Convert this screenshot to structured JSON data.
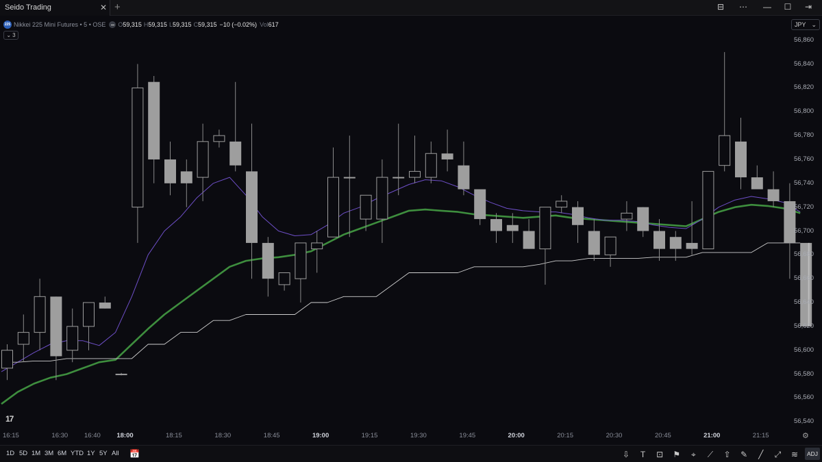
{
  "window": {
    "tab_title": "Seido Trading",
    "tab_close": "✕",
    "new_tab": "+",
    "controls": {
      "layout": "⊟",
      "more": "⋯",
      "minimize": "—",
      "maximize": "☐",
      "close": "✕",
      "exit": "⇥"
    }
  },
  "legend": {
    "badge": "225",
    "symbol": "Nikkei 225 Mini Futures • 5 • OSE",
    "open_label": "O",
    "open": "59,315",
    "high_label": "H",
    "high": "59,315",
    "low_label": "L",
    "low": "59,315",
    "close_label": "C",
    "close": "59,315",
    "change": "−10 (−0.02%)",
    "vol_label": "Vol",
    "vol": "617",
    "indicators_count": "3"
  },
  "currency": {
    "label": "JPY",
    "arrow": "⌄"
  },
  "colors": {
    "background": "#0b0b10",
    "candle": "#9e9e9e",
    "ma_green": "#3e8e3e",
    "ma_purple": "#6e4fc8",
    "baseline": "#cfcfcf"
  },
  "tv_logo": "17",
  "chart_data": {
    "type": "candlestick",
    "price_ticks": [
      56840,
      56820,
      56800,
      56780,
      56760,
      56740,
      56720,
      56700,
      56680,
      56660,
      56640,
      56620,
      56600,
      56580,
      56560,
      56540
    ],
    "price_labels": [
      "56,860",
      "56,840",
      "56,820",
      "56,800",
      "56,780",
      "56,760",
      "56,740",
      "56,720",
      "56,700",
      "56,680",
      "56,660",
      "56,640",
      "56,620",
      "56,600",
      "56,580",
      "56,560",
      "56,540"
    ],
    "ylim": [
      56535,
      56865
    ],
    "time_labels": [
      {
        "label": "16:15",
        "i": 0.5,
        "major": false
      },
      {
        "label": "16:30",
        "i": 3.5,
        "major": false
      },
      {
        "label": "16:40",
        "i": 5.5,
        "major": false
      },
      {
        "label": "18:00",
        "i": 7.5,
        "major": true
      },
      {
        "label": "18:15",
        "i": 10.5,
        "major": false
      },
      {
        "label": "18:30",
        "i": 13.5,
        "major": false
      },
      {
        "label": "18:45",
        "i": 16.5,
        "major": false
      },
      {
        "label": "19:00",
        "i": 19.5,
        "major": true
      },
      {
        "label": "19:15",
        "i": 22.5,
        "major": false
      },
      {
        "label": "19:30",
        "i": 25.5,
        "major": false
      },
      {
        "label": "19:45",
        "i": 28.5,
        "major": false
      },
      {
        "label": "20:00",
        "i": 31.5,
        "major": true
      },
      {
        "label": "20:15",
        "i": 34.5,
        "major": false
      },
      {
        "label": "20:30",
        "i": 37.5,
        "major": false
      },
      {
        "label": "20:45",
        "i": 40.5,
        "major": false
      },
      {
        "label": "21:00",
        "i": 43.5,
        "major": true
      },
      {
        "label": "21:15",
        "i": 46.5,
        "major": false
      }
    ],
    "candles": [
      [
        56585,
        56605,
        56575,
        56600
      ],
      [
        56605,
        56630,
        56590,
        56615
      ],
      [
        56615,
        56660,
        56600,
        56645
      ],
      [
        56645,
        56645,
        56575,
        56595
      ],
      [
        56600,
        56635,
        56590,
        56620
      ],
      [
        56620,
        56640,
        56600,
        56640
      ],
      [
        56640,
        56645,
        56635,
        56635
      ],
      [
        56580,
        56581,
        56579,
        56580
      ],
      [
        56720,
        56840,
        56690,
        56820
      ],
      [
        56825,
        56830,
        56740,
        56760
      ],
      [
        56760,
        56775,
        56730,
        56740
      ],
      [
        56750,
        56760,
        56720,
        56740
      ],
      [
        56745,
        56790,
        56725,
        56775
      ],
      [
        56775,
        56785,
        56770,
        56780
      ],
      [
        56775,
        56825,
        56750,
        56755
      ],
      [
        56750,
        56790,
        56660,
        56690
      ],
      [
        56690,
        56695,
        56645,
        56660
      ],
      [
        56655,
        56665,
        56650,
        56665
      ],
      [
        56660,
        56690,
        56640,
        56690
      ],
      [
        56685,
        56700,
        56665,
        56690
      ],
      [
        56695,
        56770,
        56695,
        56745
      ],
      [
        56745,
        56780,
        56695,
        56745
      ],
      [
        56710,
        56730,
        56700,
        56730
      ],
      [
        56710,
        56760,
        56690,
        56745
      ],
      [
        56745,
        56790,
        56730,
        56745
      ],
      [
        56745,
        56780,
        56740,
        56750
      ],
      [
        56745,
        56775,
        56740,
        56765
      ],
      [
        56765,
        56785,
        56750,
        56760
      ],
      [
        56755,
        56775,
        56730,
        56735
      ],
      [
        56735,
        56730,
        56705,
        56710
      ],
      [
        56710,
        56715,
        56690,
        56700
      ],
      [
        56705,
        56715,
        56690,
        56700
      ],
      [
        56700,
        56710,
        56685,
        56685
      ],
      [
        56685,
        56720,
        56655,
        56720
      ],
      [
        56720,
        56730,
        56715,
        56725
      ],
      [
        56720,
        56725,
        56690,
        56705
      ],
      [
        56700,
        56710,
        56675,
        56680
      ],
      [
        56680,
        56695,
        56670,
        56695
      ],
      [
        56710,
        56725,
        56700,
        56715
      ],
      [
        56720,
        56720,
        56695,
        56700
      ],
      [
        56700,
        56710,
        56675,
        56685
      ],
      [
        56695,
        56700,
        56675,
        56685
      ],
      [
        56690,
        56725,
        56680,
        56685
      ],
      [
        56685,
        56750,
        56685,
        56750
      ],
      [
        56755,
        56850,
        56750,
        56780
      ],
      [
        56775,
        56795,
        56735,
        56745
      ],
      [
        56745,
        56755,
        56735,
        56735
      ],
      [
        56735,
        56750,
        56720,
        56725
      ],
      [
        56725,
        56740,
        56660,
        56690
      ],
      [
        56690,
        56690,
        56620,
        56620
      ]
    ],
    "series": [
      {
        "values": [
          56555,
          56565,
          56572,
          56577,
          56580,
          56585,
          56590,
          56592,
          56605,
          56618,
          56630,
          56640,
          56650,
          56660,
          56670,
          56675,
          56677,
          56678,
          56680,
          56683,
          56690,
          56697,
          56702,
          56707,
          56712,
          56717,
          56718,
          56717,
          56716,
          56714,
          56713,
          56712,
          56711,
          56712,
          56713,
          56711,
          56710,
          56709,
          56708,
          56707,
          56706,
          56705,
          56704,
          56710,
          56716,
          56720,
          56722,
          56721,
          56719,
          56715
        ]
      },
      {
        "values": [
          56582,
          56590,
          56598,
          56605,
          56608,
          56608,
          56604,
          56615,
          56645,
          56680,
          56700,
          56712,
          56728,
          56740,
          56745,
          56730,
          56712,
          56700,
          56696,
          56697,
          56705,
          56715,
          56720,
          56727,
          56733,
          56739,
          56743,
          56742,
          56737,
          56730,
          56724,
          56719,
          56717,
          56716,
          56716,
          56714,
          56711,
          56709,
          56709,
          56708,
          56705,
          56703,
          56702,
          56710,
          56720,
          56726,
          56729,
          56727,
          56724,
          56716
        ]
      },
      {
        "values": [
          56590,
          56590,
          56591,
          56591,
          56593,
          56593,
          56593,
          56593,
          56593,
          56605,
          56605,
          56615,
          56615,
          56625,
          56625,
          56630,
          56630,
          56630,
          56630,
          56640,
          56640,
          56645,
          56645,
          56645,
          56655,
          56665,
          56665,
          56665,
          56665,
          56670,
          56670,
          56670,
          56670,
          56672,
          56675,
          56675,
          56677,
          56677,
          56677,
          56677,
          56678,
          56678,
          56678,
          56682,
          56682,
          56682,
          56682,
          56690,
          56690,
          56690
        ]
      }
    ]
  },
  "ranges": [
    "1D",
    "5D",
    "1M",
    "3M",
    "6M",
    "YTD",
    "1Y",
    "5Y",
    "All"
  ],
  "date_range_icon": "📅",
  "axis_settings_icon": "⚙",
  "tools": [
    {
      "name": "arrow-down-tool-icon",
      "glyph": "⇩"
    },
    {
      "name": "text-tool-icon",
      "glyph": "T"
    },
    {
      "name": "callout-tool-icon",
      "glyph": "⊡"
    },
    {
      "name": "flag-tool-icon",
      "glyph": "⚑"
    },
    {
      "name": "pin-tool-icon",
      "glyph": "⌖"
    },
    {
      "name": "path-tool-icon",
      "glyph": "⟋"
    },
    {
      "name": "arrow-up-tool-icon",
      "glyph": "⇧"
    },
    {
      "name": "brush-tool-icon",
      "glyph": "✎"
    },
    {
      "name": "trendline-tool-icon",
      "glyph": "╱"
    },
    {
      "name": "ray-tool-icon",
      "glyph": "⤢"
    },
    {
      "name": "measure-tool-icon",
      "glyph": "≋"
    }
  ],
  "adj_label": "ADJ"
}
